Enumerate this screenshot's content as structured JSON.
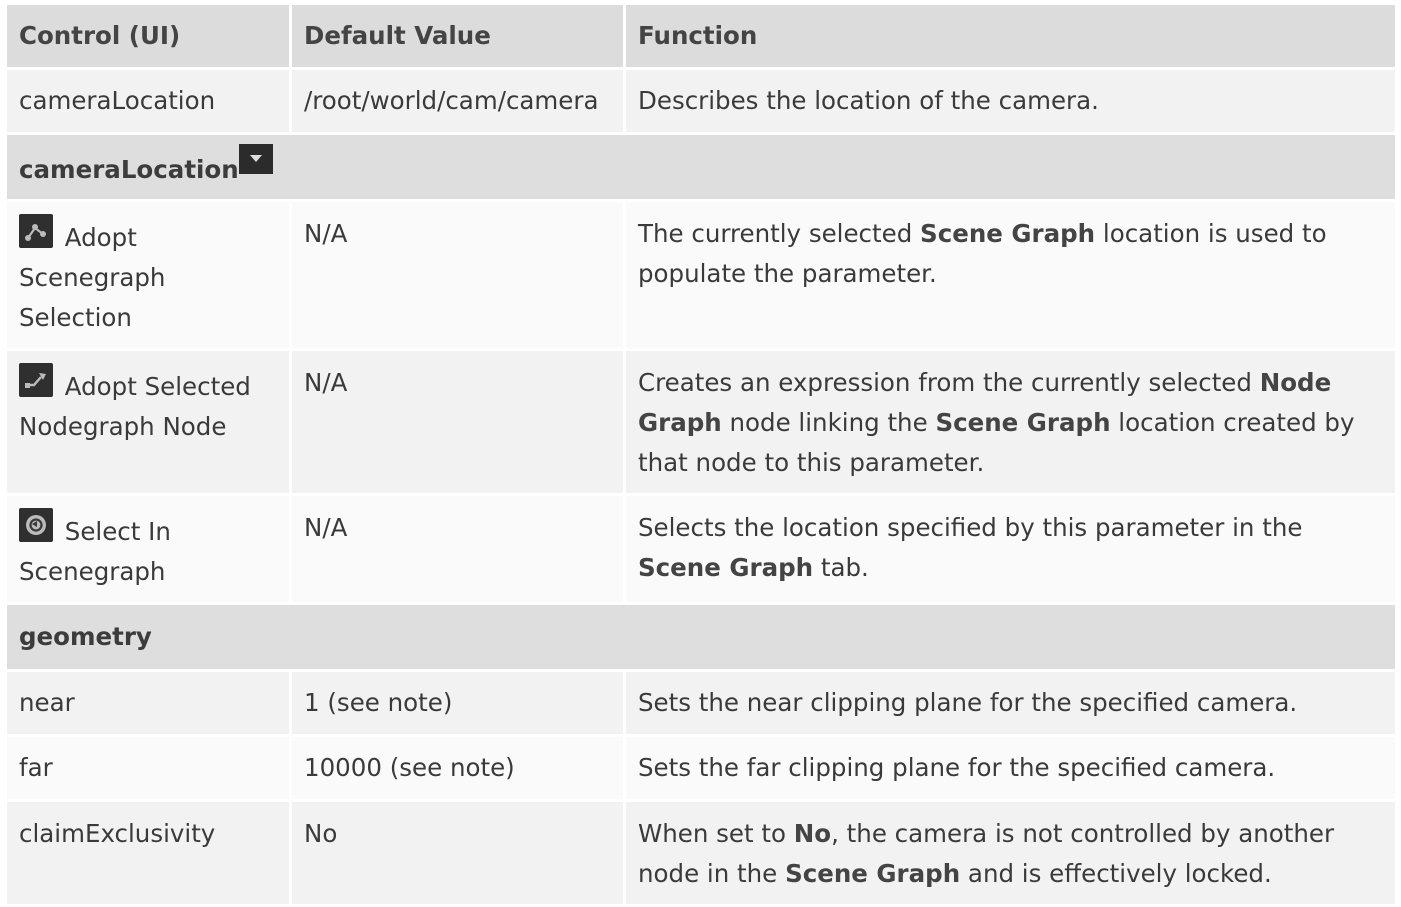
{
  "table": {
    "headers": [
      "Control (UI)",
      "Default Value",
      "Function"
    ],
    "row_camera": {
      "control": "cameraLocation",
      "default": "/root/world/cam/camera",
      "function": "Describes the location of the camera."
    },
    "section_camera": "cameraLocation",
    "row_adopt_sg": {
      "control": "Adopt Scenegraph Selection",
      "default": "N/A",
      "function": [
        "The currently selected ",
        "Scene Graph",
        " location is used to populate the parameter."
      ]
    },
    "row_adopt_node": {
      "control": "Adopt Selected Nodegraph Node",
      "default": "N/A",
      "function": [
        "Creates an expression from the currently selected ",
        "Node Graph",
        " node linking the ",
        "Scene Graph",
        " location created by that node to this parameter."
      ]
    },
    "row_select_in": {
      "control": "Select In Scenegraph",
      "default": "N/A",
      "function": [
        "Selects the location specified by this parameter in the ",
        "Scene Graph",
        " tab."
      ]
    },
    "section_geometry": "geometry",
    "row_near": {
      "control": "near",
      "default": "1 (see note)",
      "function": "Sets the near clipping plane for the specified camera."
    },
    "row_far": {
      "control": "far",
      "default": "10000 (see note)",
      "function": "Sets the far clipping plane for the specified camera."
    },
    "row_claim": {
      "control": "claimExclusivity",
      "default": "No",
      "function": [
        "When set to ",
        "No",
        ", the camera is not controlled by another node in the ",
        "Scene Graph",
        " and is effectively locked."
      ]
    }
  },
  "icons": {
    "dropdown": "chevron-down-icon",
    "adopt_sg": "adopt-scenegraph-icon",
    "adopt_node": "adopt-node-icon",
    "select_in": "select-in-scenegraph-icon"
  }
}
